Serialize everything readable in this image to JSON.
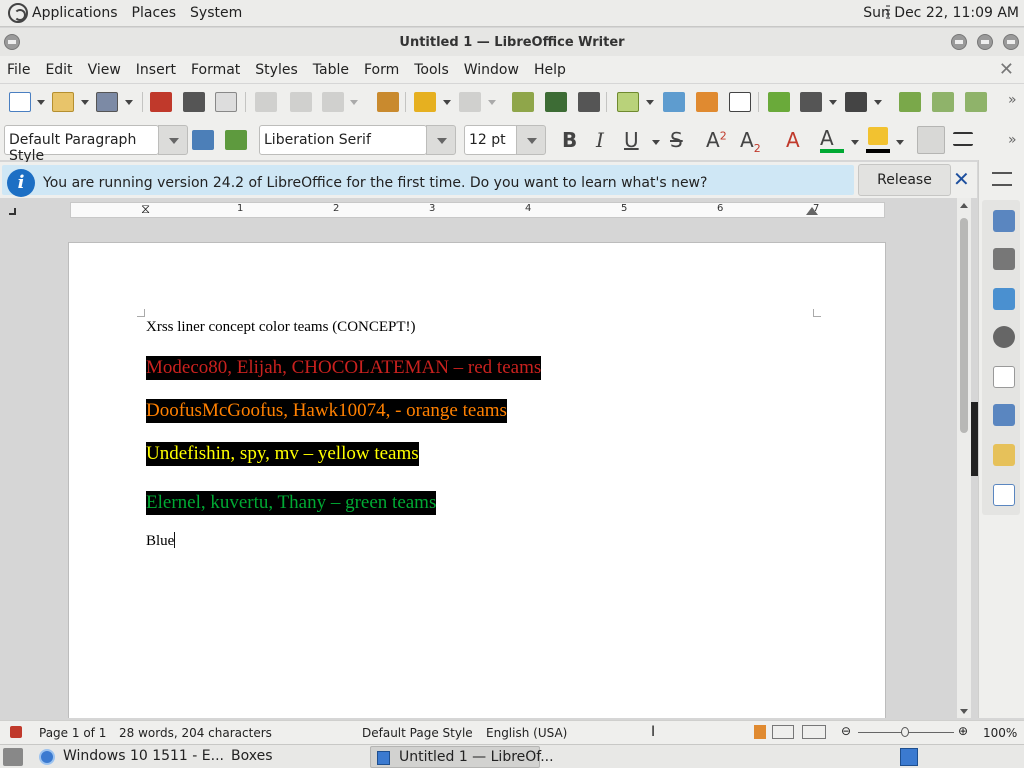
{
  "system_panel": {
    "menus": [
      "Applications",
      "Places",
      "System"
    ],
    "clock": "Sun Dec 22, 11:09 AM"
  },
  "window": {
    "title": "Untitled 1 — LibreOffice Writer"
  },
  "menubar": {
    "items": [
      "File",
      "Edit",
      "View",
      "Insert",
      "Format",
      "Styles",
      "Table",
      "Form",
      "Tools",
      "Window",
      "Help"
    ]
  },
  "formatting": {
    "paragraph_style": "Default Paragraph Style",
    "font_name": "Liberation Serif",
    "font_size": "12 pt"
  },
  "infobar": {
    "message": "You are running version 24.2 of LibreOffice for the first time. Do you want to learn what's new?",
    "button_label": "Release Notes"
  },
  "ruler": {
    "numbers": [
      "1",
      "2",
      "3",
      "4",
      "5",
      "6",
      "7"
    ]
  },
  "document": {
    "lines": [
      {
        "text": "Xrss liner concept color teams (CONCEPT!)",
        "color": "#000000",
        "highlight": false
      },
      {
        "text": "Modeco80, Elijah, CHOCOLATEMAN – red teams",
        "color": "#c9211e",
        "highlight": true
      },
      {
        "text": "DoofusMcGoofus, Hawk10074,  - orange teams",
        "color": "#ff8000",
        "highlight": true
      },
      {
        "text": "Undefishin, spy, mv – yellow teams",
        "color": "#ffff00",
        "highlight": true
      },
      {
        "text": "Elernel, kuvertu, Thany – green teams",
        "color": "#00a933",
        "highlight": true
      },
      {
        "text": "Blue",
        "color": "#000000",
        "highlight": false
      }
    ]
  },
  "statusbar": {
    "page": "Page 1 of 1",
    "word_count": "28 words, 204 characters",
    "page_style": "Default Page Style",
    "language": "English (USA)",
    "zoom": "100%"
  },
  "taskbar": {
    "tasks": [
      "Windows 10 1511 - E...",
      "Boxes",
      "Untitled 1 — LibreOf..."
    ]
  },
  "colors": {
    "highlight_bg": "#000000",
    "info_blue": "#1d6fc4",
    "font_color_swatch": "#00a933",
    "highlight_swatch": "#000000"
  }
}
